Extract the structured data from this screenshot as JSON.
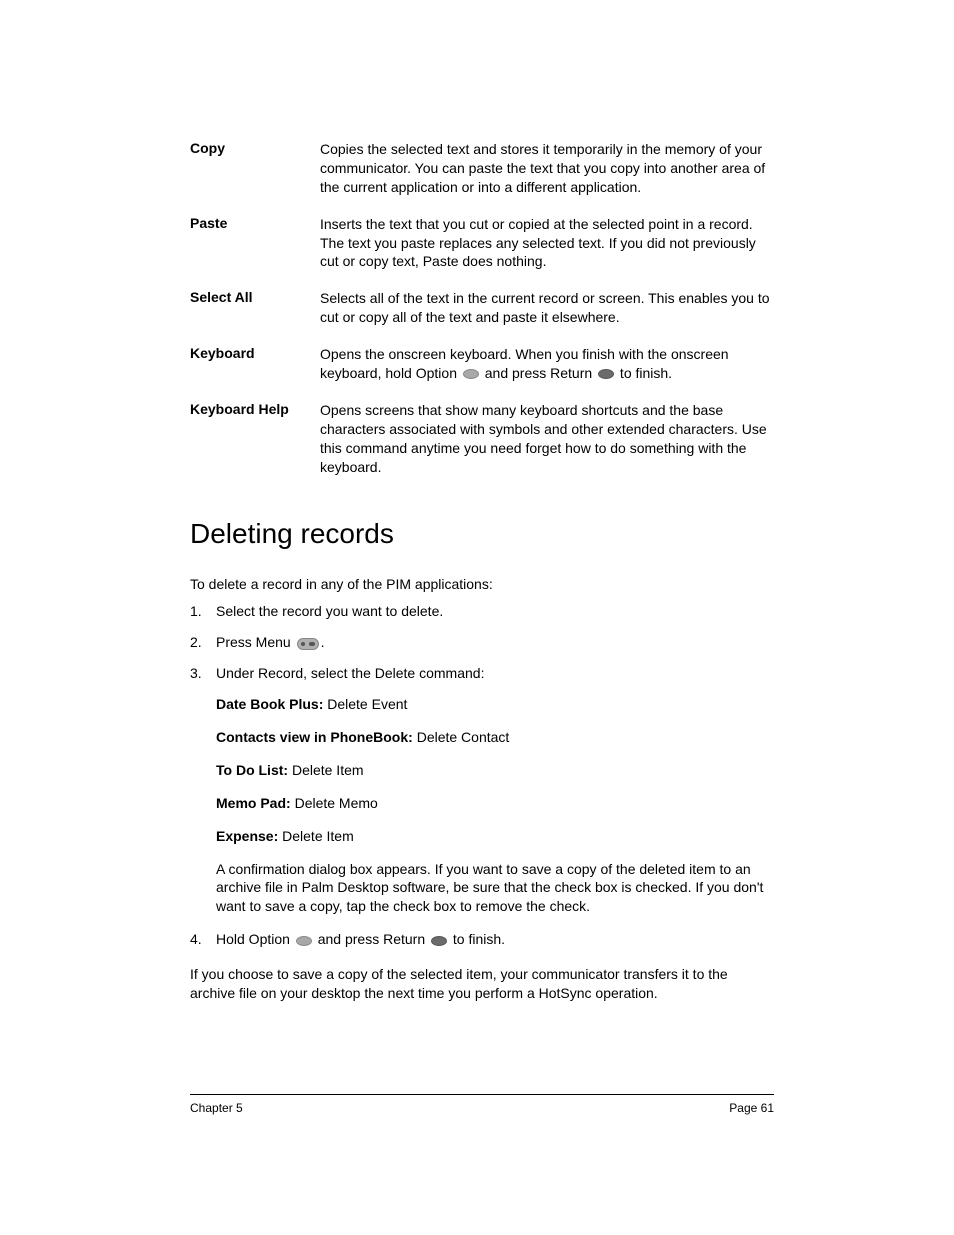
{
  "definitions": [
    {
      "term": "Copy",
      "desc": "Copies the selected text and stores it temporarily in the memory of your communicator. You can paste the text that you copy into another area of the current application or into a different application."
    },
    {
      "term": "Paste",
      "desc": "Inserts the text that you cut or copied at the selected point in a record. The text you paste replaces any selected text. If you did not previously cut or copy text, Paste does nothing."
    },
    {
      "term": "Select All",
      "desc": "Selects all of the text in the current record or screen. This enables you to cut or copy all of the text and paste it elsewhere."
    },
    {
      "term": "Keyboard",
      "desc_parts": {
        "p1": "Opens the onscreen keyboard. When you finish with the onscreen keyboard, hold Option ",
        "p2": " and press Return ",
        "p3": " to finish."
      }
    },
    {
      "term": "Keyboard Help",
      "desc": "Opens screens that show many keyboard shortcuts and the base characters associated with symbols and other extended characters. Use this command anytime you need forget how to do something with the keyboard."
    }
  ],
  "heading": "Deleting records",
  "intro": "To delete a record in any of the PIM applications:",
  "steps": {
    "s1": "Select the record you want to delete.",
    "s2_parts": {
      "p1": "Press Menu ",
      "p2": "."
    },
    "s3": "Under Record, select the Delete command:",
    "s3_sub": [
      {
        "label": "Date Book Plus:",
        "value": " Delete Event"
      },
      {
        "label": "Contacts view in PhoneBook:",
        "value": " Delete Contact"
      },
      {
        "label": "To Do List:",
        "value": " Delete Item"
      },
      {
        "label": "Memo Pad:",
        "value": " Delete Memo"
      },
      {
        "label": "Expense:",
        "value": " Delete Item"
      }
    ],
    "s3_confirm": "A confirmation dialog box appears. If you want to save a copy of the deleted item to an archive file in Palm Desktop software, be sure that the check box is checked. If you don't want to save a copy, tap the check box to remove the check.",
    "s4_parts": {
      "p1": "Hold Option ",
      "p2": " and press Return ",
      "p3": " to finish."
    }
  },
  "closing": "If you choose to save a copy of the selected item, your communicator transfers it to the archive file on your desktop the next time you perform a HotSync operation.",
  "footer": {
    "left": "Chapter 5",
    "right": "Page 61"
  }
}
